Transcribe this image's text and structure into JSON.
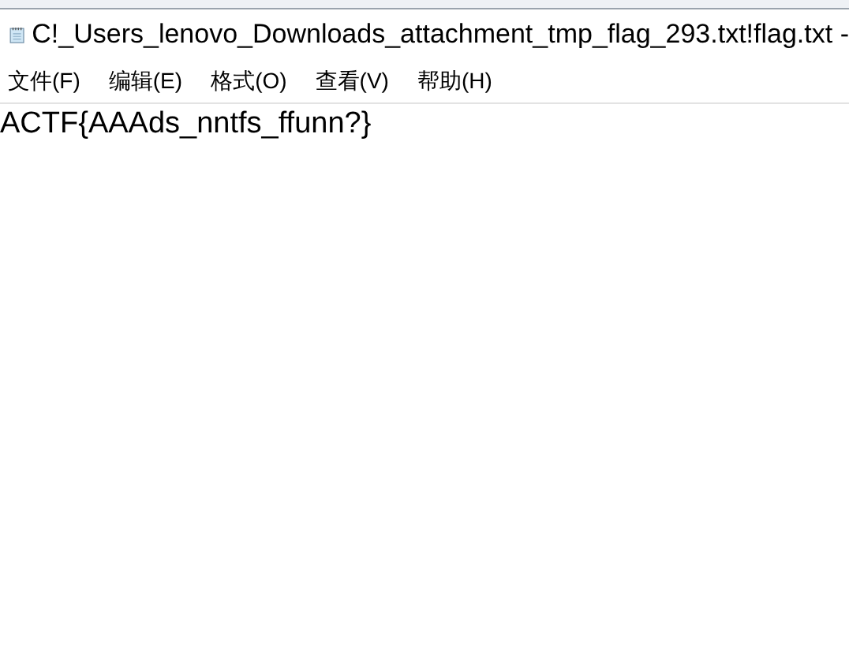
{
  "window": {
    "title": "C!_Users_lenovo_Downloads_attachment_tmp_flag_293.txt!flag.txt -"
  },
  "menu": [
    "文件(F)",
    "编辑(E)",
    "格式(O)",
    "查看(V)",
    "帮助(H)"
  ],
  "editor": {
    "text": "ACTF{AAAds_nntfs_ffunn?}"
  }
}
